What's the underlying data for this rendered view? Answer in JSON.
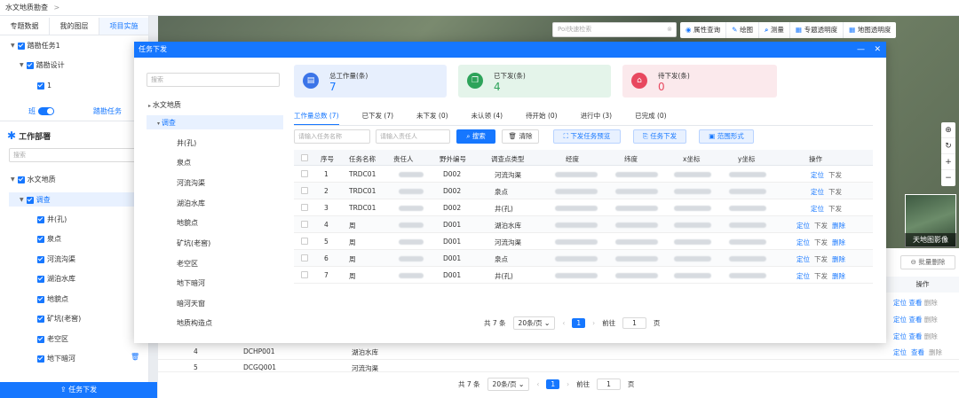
{
  "breadcrumb": {
    "title": "水文地质勘查",
    "sep": ">"
  },
  "left": {
    "tabs": [
      "专题数据",
      "我的图层",
      "项目实施"
    ],
    "tree1": [
      {
        "label": "踏勘任务1",
        "level": 0
      },
      {
        "label": "踏勘设计",
        "level": 1
      },
      {
        "label": "1",
        "level": 2
      }
    ],
    "toggle_label": "班",
    "toggle_right": "踏勘任务",
    "section_title": "工作部署",
    "search_placeholder": "搜索",
    "tree2_root": "水文地质",
    "tree2_sub": "调查",
    "tree2_items": [
      "井(孔)",
      "泉点",
      "河流沟渠",
      "湖泊水库",
      "地貌点",
      "矿坑(老窖)",
      "老空区",
      "地下暗河"
    ],
    "bottom_button": "任务下发"
  },
  "map": {
    "poi_placeholder": "Poi快速检索",
    "toolbar": [
      "属性查询",
      "绘图",
      "测量",
      "专题透明度",
      "地图透明度"
    ],
    "minimap_label": "天地图影像",
    "bg_batch": "批量删除",
    "bg_op_header": "操作",
    "bg_rows": [
      {
        "no": "4",
        "code": "DCHP001",
        "type": "湖泊水库"
      },
      {
        "no": "5",
        "code": "DCGQ001",
        "type": "河流沟渠"
      }
    ],
    "bg_pager": {
      "total": "共 7 条",
      "size": "20条/页",
      "page": "1",
      "goto": "前往",
      "goto_val": "1",
      "unit": "页"
    },
    "bg_ops": [
      "定位",
      "查看",
      "删除"
    ]
  },
  "modal": {
    "title": "任务下发",
    "search_placeholder": "搜索",
    "tree_root": "水文地质",
    "tree_sub": "调查",
    "tree_items": [
      "井(孔)",
      "泉点",
      "河流沟渠",
      "湖泊水库",
      "地貌点",
      "矿坑(老窖)",
      "老空区",
      "地下暗河",
      "暗河天窗",
      "地质构造点"
    ],
    "cards": [
      {
        "label": "总工作量(条)",
        "value": "7",
        "bg": "#e7effd",
        "icon_bg": "#3b74e8",
        "val_color": "#1677ff"
      },
      {
        "label": "已下发(条)",
        "value": "4",
        "bg": "#e4f4ea",
        "icon_bg": "#2ea35a",
        "val_color": "#2ea35a"
      },
      {
        "label": "待下发(条)",
        "value": "0",
        "bg": "#fbe9ec",
        "icon_bg": "#e8485f",
        "val_color": "#e8485f"
      }
    ],
    "status_tabs": [
      "工作量总数 (7)",
      "已下发 (7)",
      "未下发 (0)",
      "未认领 (4)",
      "待开始 (0)",
      "进行中 (3)",
      "已完成 (0)"
    ],
    "filter": {
      "task_placeholder": "请输入任务名称",
      "person_placeholder": "请输入责任人"
    },
    "buttons": {
      "search": "搜索",
      "clear": "清除",
      "preview": "下发任务预览",
      "issue": "任务下发",
      "range": "范围形式"
    },
    "headers": [
      "序号",
      "任务名称",
      "责任人",
      "野外编号",
      "调查点类型",
      "经度",
      "纬度",
      "x坐标",
      "y坐标",
      "操作"
    ],
    "rows": [
      {
        "no": "1",
        "task": "TRDC01",
        "code": "D002",
        "type": "河流沟渠",
        "ops": [
          "定位",
          "下发"
        ]
      },
      {
        "no": "2",
        "task": "TRDC01",
        "code": "D002",
        "type": "泉点",
        "ops": [
          "定位",
          "下发"
        ]
      },
      {
        "no": "3",
        "task": "TRDC01",
        "code": "D002",
        "type": "井(孔)",
        "ops": [
          "定位",
          "下发"
        ]
      },
      {
        "no": "4",
        "task": "周",
        "code": "D001",
        "type": "湖泊水库",
        "ops": [
          "定位",
          "下发",
          "删除"
        ]
      },
      {
        "no": "5",
        "task": "周",
        "code": "D001",
        "type": "河流沟渠",
        "ops": [
          "定位",
          "下发",
          "删除"
        ]
      },
      {
        "no": "6",
        "task": "周",
        "code": "D001",
        "type": "泉点",
        "ops": [
          "定位",
          "下发",
          "删除"
        ]
      },
      {
        "no": "7",
        "task": "周",
        "code": "D001",
        "type": "井(孔)",
        "ops": [
          "定位",
          "下发",
          "删除"
        ]
      }
    ],
    "pager": {
      "total": "共 7 条",
      "size": "20条/页",
      "page": "1",
      "goto": "前往",
      "goto_val": "1",
      "unit": "页"
    }
  }
}
